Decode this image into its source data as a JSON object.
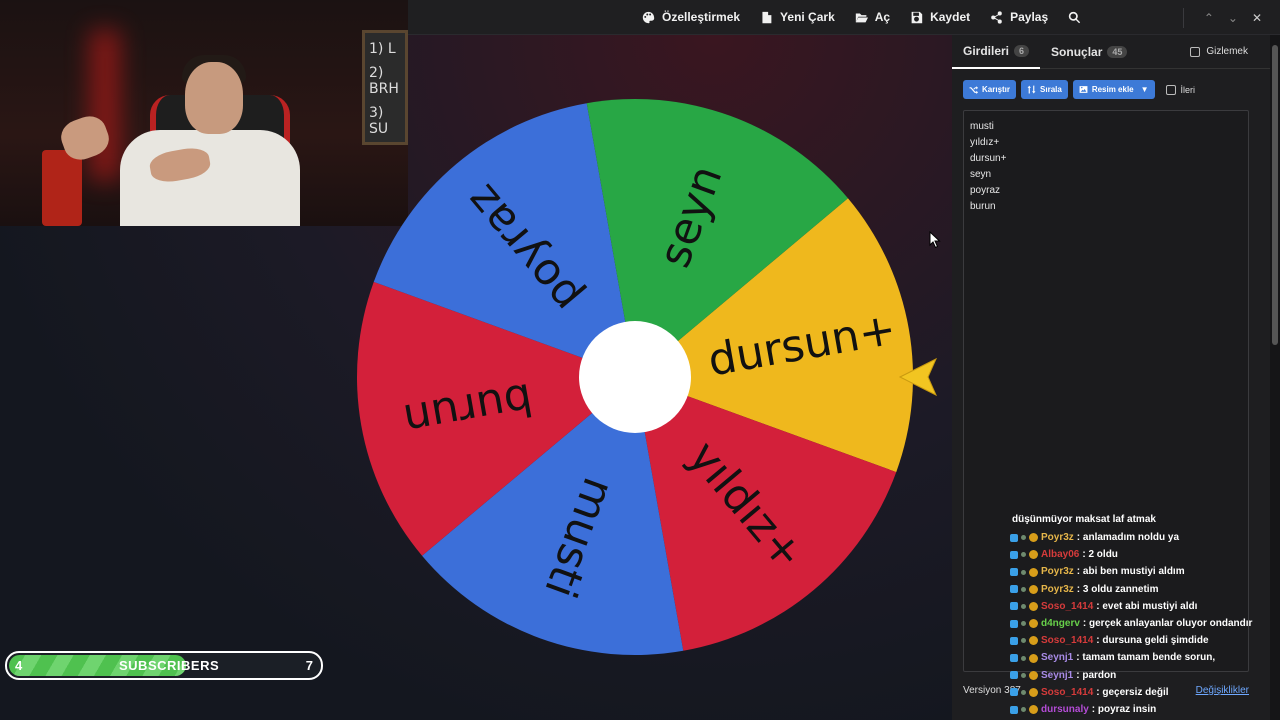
{
  "toolbar": {
    "items": [
      {
        "label": "Özelleştirmek",
        "icon": "palette-icon"
      },
      {
        "label": "Yeni Çark",
        "icon": "new-file-icon"
      },
      {
        "label": "Aç",
        "icon": "folder-open-icon"
      },
      {
        "label": "Kaydet",
        "icon": "save-icon"
      },
      {
        "label": "Paylaş",
        "icon": "share-icon"
      },
      {
        "label": "",
        "icon": "search-icon"
      }
    ],
    "window_controls": [
      "chevron-up-icon",
      "chevron-down-icon",
      "close-icon"
    ]
  },
  "webcam": {
    "board_text": [
      "1) L",
      "2) BRH",
      "3) SU"
    ]
  },
  "wheel": {
    "segments": [
      {
        "label": "dursun+",
        "color": "#efb81d"
      },
      {
        "label": "yıldız+",
        "color": "#d3203a"
      },
      {
        "label": "musti",
        "color": "#3c6fd9"
      },
      {
        "label": "burun",
        "color": "#d3203a"
      },
      {
        "label": "poyraz",
        "color": "#3c6fd9"
      },
      {
        "label": "seyn",
        "color": "#28a745"
      }
    ],
    "pointer_color": "#f2c521"
  },
  "subscriber_goal": {
    "current": "4",
    "label": "SUBSCRIBERS",
    "target": "7",
    "progress": 0.57,
    "fill_color": "#4fc14f"
  },
  "panel": {
    "tabs": [
      {
        "label": "Girdileri",
        "count": "6",
        "active": true
      },
      {
        "label": "Sonuçlar",
        "count": "45",
        "active": false
      }
    ],
    "hide_label": "Gizlemek",
    "buttons": [
      {
        "label": "Karıştır",
        "icon": "shuffle-icon"
      },
      {
        "label": "Sırala",
        "icon": "sort-icon"
      },
      {
        "label": "Resim ekle",
        "icon": "image-icon"
      }
    ],
    "advanced_label": "İleri",
    "entries": [
      "musti",
      "yıldız+",
      "dursun+",
      "seyn",
      "poyraz",
      "burun"
    ],
    "version": "Versiyon 387",
    "changes_link": "Değişiklikler"
  },
  "chat": {
    "header": "düşünmüyor maksat laf atmak",
    "messages": [
      {
        "user": "Poyr3z",
        "user_color": "#e6b64a",
        "text": ": anlamadım noldu ya"
      },
      {
        "user": "Albay06",
        "user_color": "#d63b3b",
        "text": ": 2 oldu"
      },
      {
        "user": "Poyr3z",
        "user_color": "#e6b64a",
        "text": ": abi ben mustiyi aldım"
      },
      {
        "user": "Poyr3z",
        "user_color": "#e6b64a",
        "text": ": 3 oldu zannetim"
      },
      {
        "user": "Soso_1414",
        "user_color": "#d63b3b",
        "text": ": evet abi mustiyi aldı"
      },
      {
        "user": "d4ngerv",
        "user_color": "#67d14a",
        "text": ": gerçek anlayanlar oluyor ondandır"
      },
      {
        "user": "Soso_1414",
        "user_color": "#d63b3b",
        "text": ": dursuna geldi şimdide"
      },
      {
        "user": "Seynj1",
        "user_color": "#a88be6",
        "text": ": tamam tamam bende sorun,"
      },
      {
        "user": "Seynj1",
        "user_color": "#a88be6",
        "text": ": pardon"
      },
      {
        "user": "Soso_1414",
        "user_color": "#d63b3b",
        "text": ": geçersiz değil"
      },
      {
        "user": "dursunaly",
        "user_color": "#b44cd6",
        "text": ": poyraz insin"
      }
    ]
  }
}
